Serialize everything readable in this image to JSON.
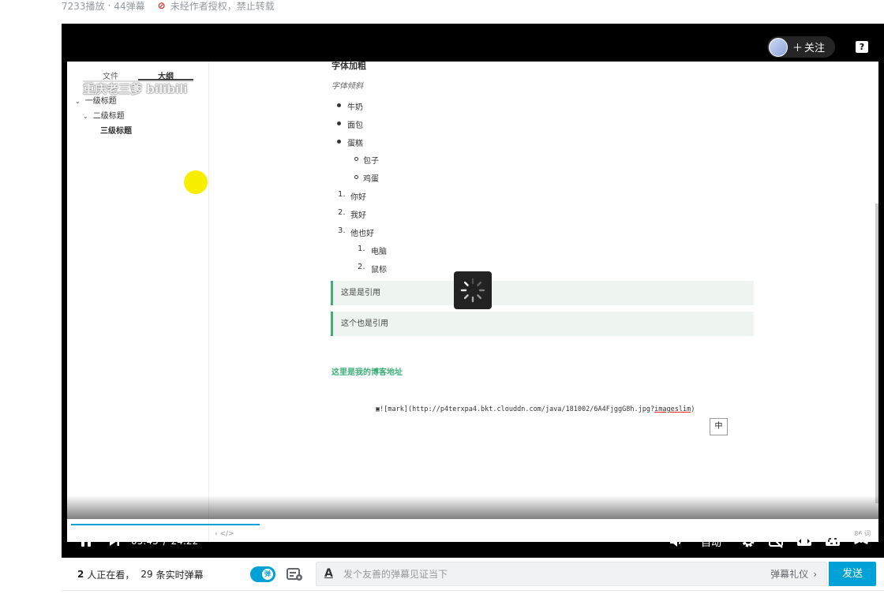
{
  "video_stats": {
    "plays": "7233播放",
    "dot": "·",
    "danmaku_count": "44弹幕",
    "copyright_notice": "未经作者授权，禁止转载"
  },
  "uploader": {
    "follow_label": "关注"
  },
  "help_label": "?",
  "watermark": "重庆老三爹 bilibili",
  "editor": {
    "sidebar_tabs": [
      "文件",
      "大纲"
    ],
    "outline": [
      {
        "label": "一级标题",
        "level": 1
      },
      {
        "label": "二级标题",
        "level": 2
      },
      {
        "label": "三级标题",
        "level": 3
      }
    ],
    "bold_text": "字体加粗",
    "italic_text": "字体倾斜",
    "bullet_items": [
      "牛奶",
      "面包",
      "蛋糕"
    ],
    "sub_bullets": [
      "包子",
      "鸡蛋"
    ],
    "ordered_items": [
      "1.",
      "你好",
      "2.",
      "我好",
      "3.",
      "他也好"
    ],
    "sub_ordered": [
      "1.",
      "电脑",
      "2.",
      "鼠标"
    ],
    "quotes": [
      "这是是引用",
      "这个也是引用"
    ],
    "blog_heading": "这里是我的博客地址",
    "code_line_prefix": "![mark](http://p4terxpa4.bkt.clouddn.com/java/181002/6A4FjggG8h.jpg?",
    "code_line_underlined": "imageslim",
    "code_line_suffix": ")",
    "ime_label": "中",
    "word_count": "86 词",
    "bottom_icons": "‹  </>"
  },
  "player": {
    "current_time": "05:43",
    "time_sep": "/",
    "duration": "24:22",
    "progress_fraction": 0.234,
    "buffered_fraction": 0.278,
    "quality_label": "自动"
  },
  "danmaku_bar": {
    "watching_count": "2",
    "watching_text": "人正在看，",
    "realtime_count": "29",
    "realtime_text": "条实时弹幕",
    "toggle_label": "弹",
    "input_placeholder": "发个友善的弹幕见证当下",
    "etiquette_label": "弹幕礼仪",
    "send_label": "发送"
  },
  "colors": {
    "accent": "#00a1d6",
    "quote_border": "#3daf78",
    "warning": "#e02e24"
  }
}
